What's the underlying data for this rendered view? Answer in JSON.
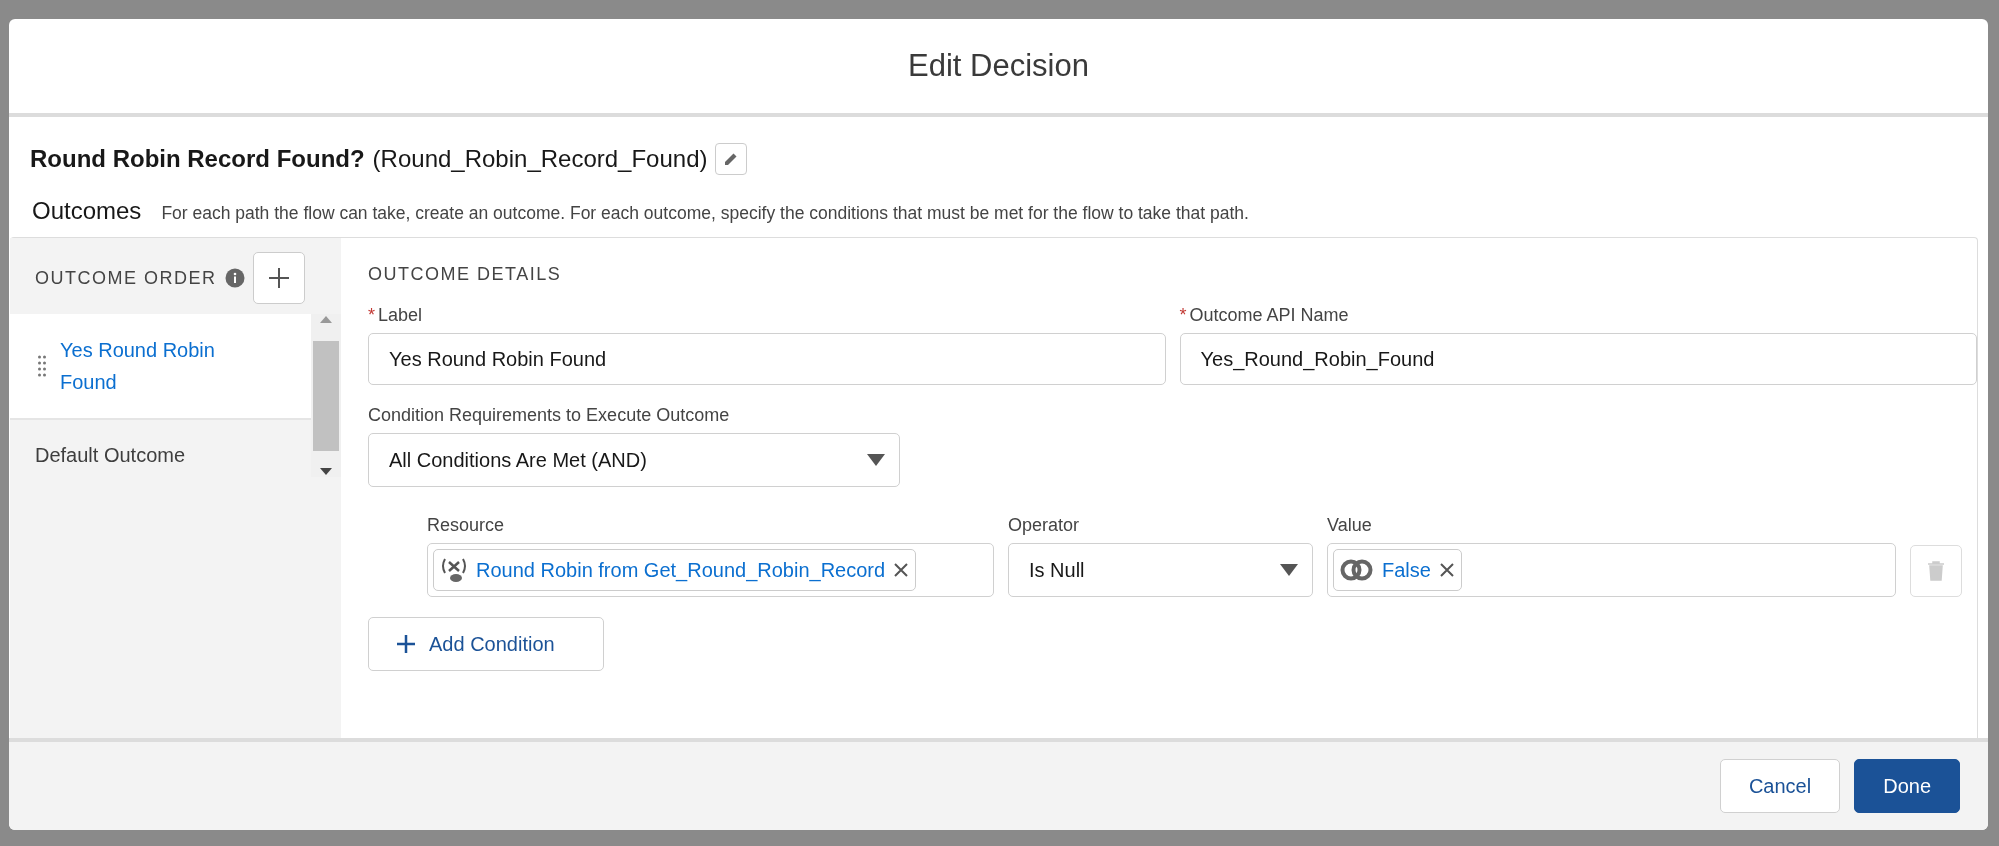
{
  "dialog": {
    "title": "Edit Decision"
  },
  "element": {
    "label": "Round Robin Record Found?",
    "api_name": "(Round_Robin_Record_Found)"
  },
  "outcomes_section": {
    "heading": "Outcomes",
    "description": "For each path the flow can take, create an outcome. For each outcome, specify the conditions that must be met for the flow to take that path."
  },
  "outcome_order": {
    "heading": "OUTCOME ORDER",
    "items": [
      {
        "label": "Yes Round Robin Found",
        "selected": true
      },
      {
        "label": "Default Outcome",
        "selected": false
      }
    ]
  },
  "outcome_details": {
    "heading": "OUTCOME DETAILS",
    "fields": [
      {
        "label": "Label",
        "required_mark": "*",
        "value": "Yes Round Robin Found"
      },
      {
        "label": "Outcome API Name",
        "required_mark": "*",
        "value": "Yes_Round_Robin_Found"
      }
    ],
    "condition_requirements": {
      "label": "Condition Requirements to Execute Outcome",
      "value": "All Conditions Are Met (AND)"
    },
    "conditions": [
      {
        "resource_label": "Resource",
        "resource": "Round Robin from Get_Round_Robin_Record",
        "operator_label": "Operator",
        "operator": "Is Null",
        "value_label": "Value",
        "value": "False"
      }
    ],
    "add_condition": "Add Condition"
  },
  "footer": {
    "buttons": [
      {
        "label": "Cancel",
        "kind": "neutral"
      },
      {
        "label": "Done",
        "kind": "brand"
      }
    ]
  }
}
